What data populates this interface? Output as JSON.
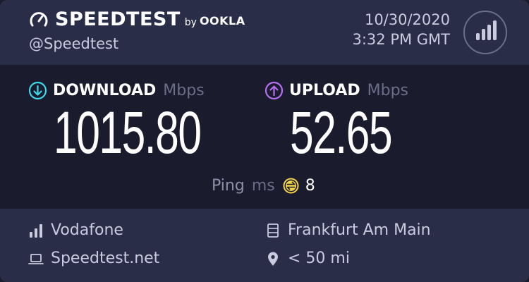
{
  "header": {
    "brand": "SPEEDTEST",
    "by": "by",
    "company": "OOKLA",
    "handle": "@Speedtest",
    "date": "10/30/2020",
    "time": "3:32 PM GMT"
  },
  "download": {
    "label": "DOWNLOAD",
    "unit": "Mbps",
    "value": "1015.80",
    "accent": "#3dd8e8"
  },
  "upload": {
    "label": "UPLOAD",
    "unit": "Mbps",
    "value": "52.65",
    "accent": "#b86ef0"
  },
  "ping": {
    "label": "Ping",
    "unit": "ms",
    "value": "8",
    "accent": "#f5d547"
  },
  "footer": {
    "isp": "Vodafone",
    "host": "Speedtest.net",
    "server": "Frankfurt Am Main",
    "distance": "< 50 mi",
    "icons": [
      "signal-bars-icon",
      "laptop-icon",
      "server-icon",
      "location-pin-icon"
    ]
  }
}
